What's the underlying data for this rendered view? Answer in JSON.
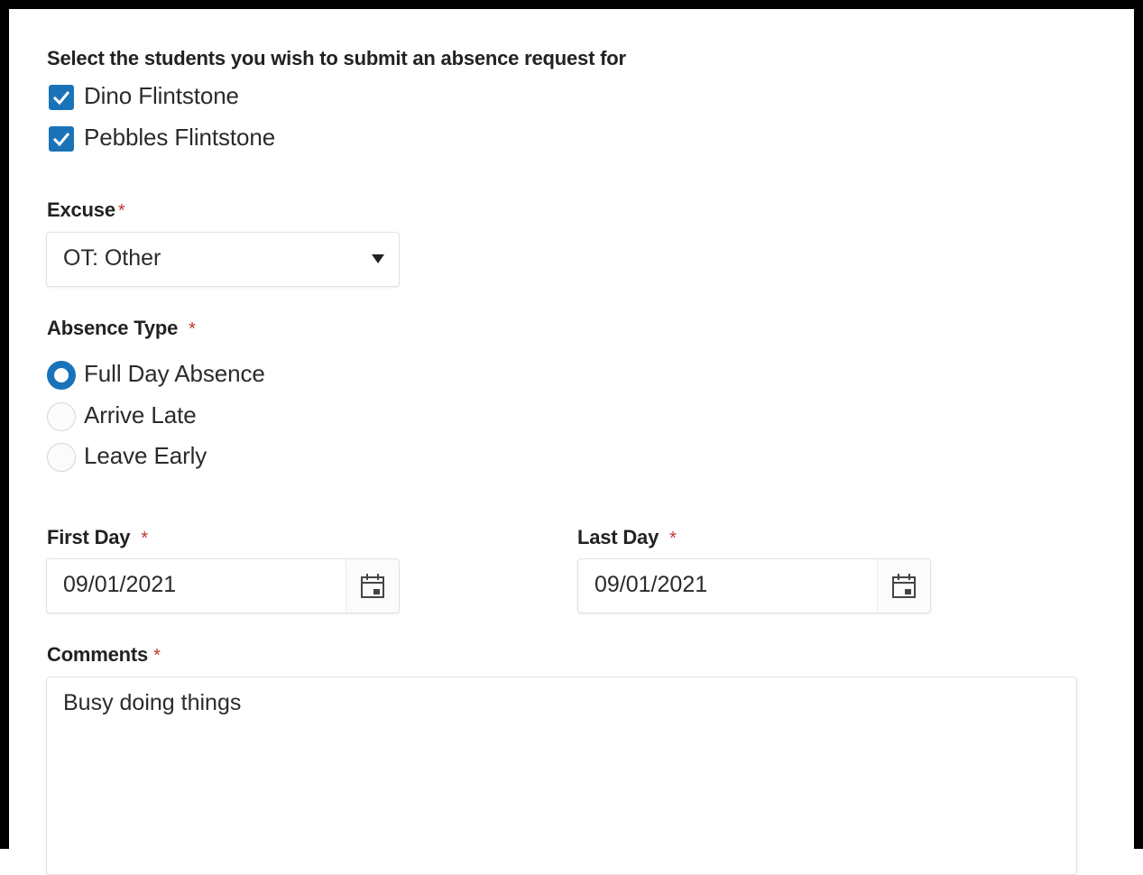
{
  "students": {
    "heading": "Select the students you wish to submit an absence request for",
    "items": [
      {
        "name": "Dino Flintstone",
        "checked": true
      },
      {
        "name": "Pebbles Flintstone",
        "checked": true
      }
    ]
  },
  "excuse": {
    "label": "Excuse",
    "required_mark": "*",
    "selected": "OT: Other"
  },
  "absence_type": {
    "label": "Absence Type",
    "required_mark": "*",
    "options": [
      {
        "label": "Full Day Absence",
        "selected": true
      },
      {
        "label": "Arrive Late",
        "selected": false
      },
      {
        "label": "Leave Early",
        "selected": false
      }
    ]
  },
  "first_day": {
    "label": "First Day",
    "required_mark": "*",
    "value": "09/01/2021",
    "icon": "calendar-icon"
  },
  "last_day": {
    "label": "Last Day",
    "required_mark": "*",
    "value": "09/01/2021",
    "icon": "calendar-icon"
  },
  "comments": {
    "label": "Comments",
    "required_mark": "*",
    "value": "Busy doing things"
  },
  "colors": {
    "accent": "#1a73b8",
    "required": "#c0392b"
  }
}
